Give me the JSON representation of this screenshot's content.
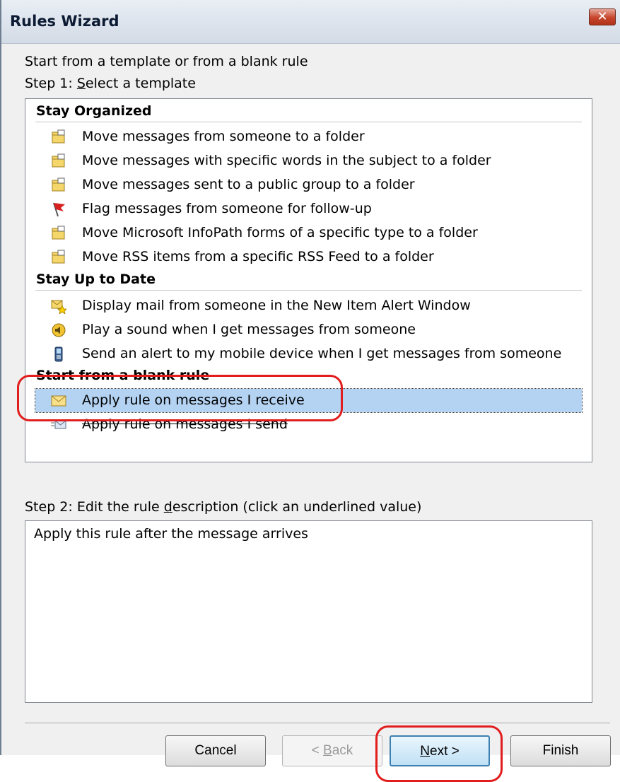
{
  "window": {
    "title": "Rules Wizard",
    "close_glyph": "✕"
  },
  "intro": "Start from a template or from a blank rule",
  "step1": {
    "before": "Step 1: ",
    "accel": "S",
    "after": "elect a template"
  },
  "groups": [
    {
      "header": "Stay Organized",
      "items": [
        {
          "icon": "folder-move-icon",
          "label": "Move messages from someone to a folder"
        },
        {
          "icon": "folder-move-icon",
          "label": "Move messages with specific words in the subject to a folder"
        },
        {
          "icon": "folder-move-icon",
          "label": "Move messages sent to a public group to a folder"
        },
        {
          "icon": "flag-icon",
          "label": "Flag messages from someone for follow-up"
        },
        {
          "icon": "folder-move-icon",
          "label": "Move Microsoft InfoPath forms of a specific type to a folder"
        },
        {
          "icon": "folder-move-icon",
          "label": "Move RSS items from a specific RSS Feed to a folder"
        }
      ]
    },
    {
      "header": "Stay Up to Date",
      "items": [
        {
          "icon": "alert-window-icon",
          "label": "Display mail from someone in the New Item Alert Window"
        },
        {
          "icon": "speaker-icon",
          "label": "Play a sound when I get messages from someone"
        },
        {
          "icon": "mobile-device-icon",
          "label": "Send an alert to my mobile device when I get messages from someone"
        }
      ]
    },
    {
      "header": "Start from a blank rule",
      "items": [
        {
          "icon": "envelope-icon",
          "label": "Apply rule on messages I receive",
          "selected": true
        },
        {
          "icon": "outbox-envelope-icon",
          "label": "Apply rule on messages I send"
        }
      ]
    }
  ],
  "step2": {
    "before": "Step 2: Edit the rule ",
    "accel": "d",
    "after": "escription (click an underlined value)"
  },
  "description": "Apply this rule after the message arrives",
  "buttons": {
    "cancel": "Cancel",
    "back": {
      "before": "< ",
      "accel": "B",
      "after": "ack"
    },
    "next": {
      "accel": "N",
      "after": "ext >"
    },
    "finish": "Finish"
  },
  "colors": {
    "selection": "#b4d3f3",
    "highlight_oval": "#e11d1d"
  }
}
